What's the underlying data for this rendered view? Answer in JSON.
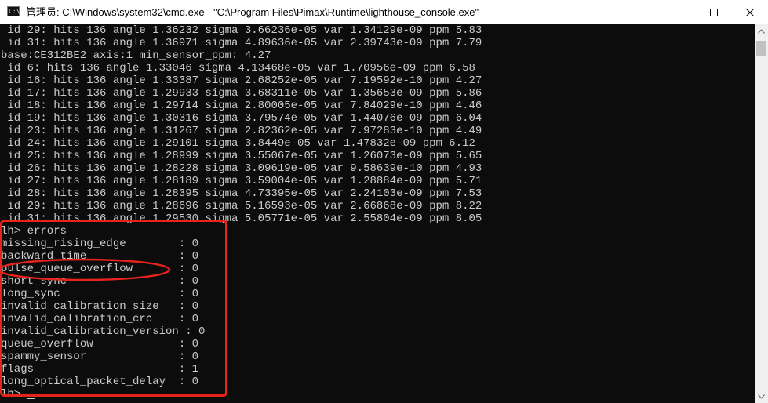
{
  "window": {
    "icon_text": "C:\\",
    "title": "管理员: C:\\Windows\\system32\\cmd.exe - \"C:\\Program Files\\Pimax\\Runtime\\lighthouse_console.exe\""
  },
  "controls": {
    "minimize_icon": "minimize-icon",
    "maximize_icon": "maximize-icon",
    "close_icon": "close-icon"
  },
  "console": {
    "lines": [
      " id 29: hits 136 angle 1.36232 sigma 3.66236e-05 var 1.34129e-09 ppm 5.83",
      " id 31: hits 136 angle 1.36971 sigma 4.89636e-05 var 2.39743e-09 ppm 7.79",
      "base:CE312BE2 axis:1 min_sensor_ppm: 4.27",
      " id 6: hits 136 angle 1.33046 sigma 4.13468e-05 var 1.70956e-09 ppm 6.58",
      " id 16: hits 136 angle 1.33387 sigma 2.68252e-05 var 7.19592e-10 ppm 4.27",
      " id 17: hits 136 angle 1.29933 sigma 3.68311e-05 var 1.35653e-09 ppm 5.86",
      " id 18: hits 136 angle 1.29714 sigma 2.80005e-05 var 7.84029e-10 ppm 4.46",
      " id 19: hits 136 angle 1.30316 sigma 3.79574e-05 var 1.44076e-09 ppm 6.04",
      " id 23: hits 136 angle 1.31267 sigma 2.82362e-05 var 7.97283e-10 ppm 4.49",
      " id 24: hits 136 angle 1.29101 sigma 3.8449e-05 var 1.47832e-09 ppm 6.12",
      " id 25: hits 136 angle 1.28999 sigma 3.55067e-05 var 1.26073e-09 ppm 5.65",
      " id 26: hits 136 angle 1.28228 sigma 3.09619e-05 var 9.58639e-10 ppm 4.93",
      " id 27: hits 136 angle 1.28189 sigma 3.59004e-05 var 1.28884e-09 ppm 5.71",
      " id 28: hits 136 angle 1.28395 sigma 4.73395e-05 var 2.24103e-09 ppm 7.53",
      " id 29: hits 136 angle 1.28696 sigma 5.16593e-05 var 2.66868e-09 ppm 8.22",
      " id 31: hits 136 angle 1.29530 sigma 5.05771e-05 var 2.55804e-09 ppm 8.05",
      "lh> errors",
      "missing_rising_edge        : 0",
      "backward_time              : 0",
      "pulse_queue_overflow       : 0",
      "short_sync                 : 0",
      "long_sync                  : 0",
      "invalid_calibration_size   : 0",
      "invalid_calibration_crc    : 0",
      "invalid_calibration_version : 0",
      "queue_overflow             : 0",
      "spammy_sensor              : 0",
      "flags                      : 1",
      "long_optical_packet_delay  : 0"
    ],
    "prompt": "lh> "
  },
  "annotations": {
    "highlight_color": "#e8231b"
  }
}
